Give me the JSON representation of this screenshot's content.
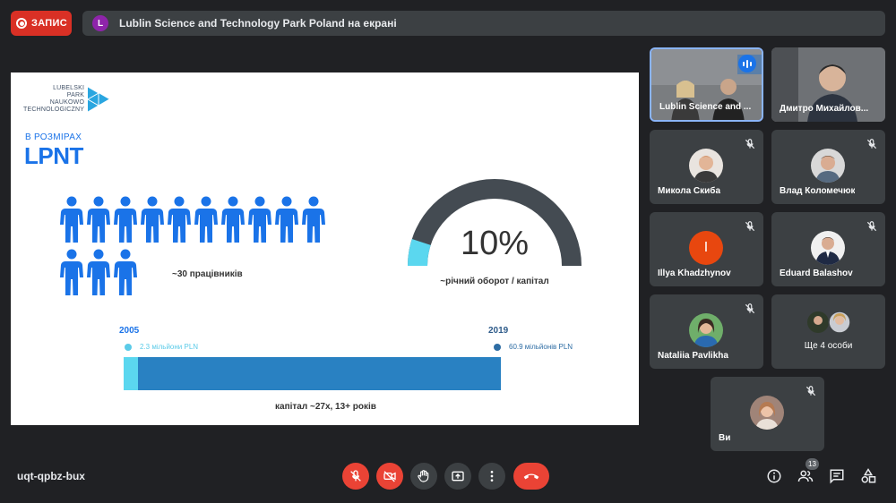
{
  "recording": {
    "label": "ЗАПИС",
    "color": "#d93025"
  },
  "presenter": {
    "initial": "L",
    "text": "Lublin Science and Technology Park Poland на екрані"
  },
  "slide": {
    "logo_lines": [
      "LUBELSKI",
      "PARK",
      "NAUKOWO",
      "TECHNOLOGICZNY"
    ],
    "sub_heading": "В РОЗМІРАХ",
    "heading": "LPNT",
    "employees_label": "~30 працівників",
    "gauge": {
      "value_text": "10%",
      "fraction": 0.1,
      "label": "~річний оборот / капітал"
    },
    "capital": {
      "start_year": "2005",
      "start_value": "2.3 мільйони PLN",
      "end_year": "2019",
      "end_value": "60.9 мільйонів PLN",
      "start_fraction": 0.038,
      "label": "капітал ~27х, 13+ років"
    },
    "colors": {
      "accent": "#1a73e8",
      "light_bar": "#5bd7ef",
      "dark_bar": "#2981c2",
      "gauge_dark": "#444b52"
    }
  },
  "participants": [
    {
      "name": "Lublin Science and ...",
      "speaking": true
    },
    {
      "name": "Дмитро Михайлов..."
    },
    {
      "name": "Микола Скиба",
      "muted": true
    },
    {
      "name": "Влад Коломечюк",
      "muted": true
    },
    {
      "name": "Illya Khadzhynov",
      "initial": "I",
      "avatar_color": "#e8470f",
      "muted": true
    },
    {
      "name": "Eduard Balashov",
      "muted": true
    },
    {
      "name": "Nataliia Pavlikha",
      "muted": true
    },
    {
      "more_label": "Ще 4 особи"
    },
    {
      "name": "Ви",
      "muted": true
    }
  ],
  "bottom": {
    "meeting_code": "uqt-qpbz-bux",
    "people_count": "13"
  }
}
